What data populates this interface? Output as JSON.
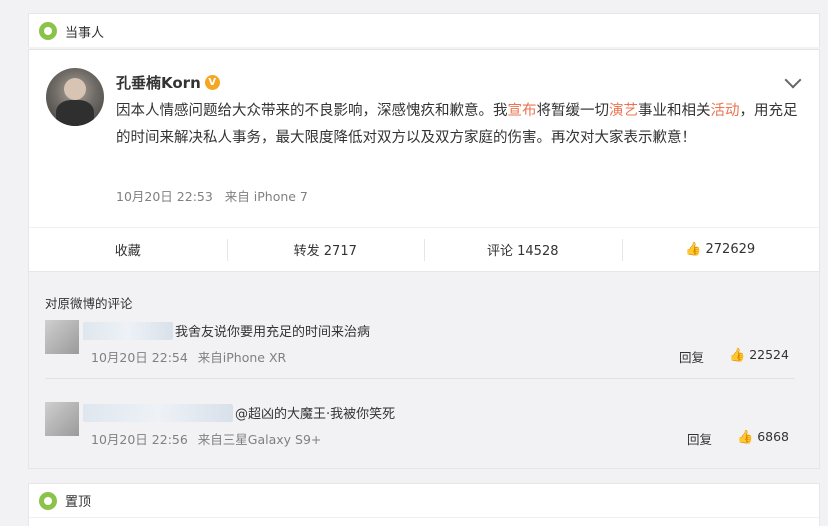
{
  "top_section": {
    "label": "当事人"
  },
  "post": {
    "author": "孔垂楠Korn",
    "verified_mark": "V",
    "text_parts": [
      {
        "text": "因本人情感问题给大众带来的不良影响，深感愧疚和歉意。我",
        "hl": false
      },
      {
        "text": "宣布",
        "hl": true
      },
      {
        "text": "将暂缓一切",
        "hl": false
      },
      {
        "text": "演艺",
        "hl": true
      },
      {
        "text": "事业和相关",
        "hl": false
      },
      {
        "text": "活动",
        "hl": true
      },
      {
        "text": "，用充足的时间来解决私人事务，最大限度降低对双方以及双方家庭的伤害。再次对大家表示歉意！",
        "hl": false
      }
    ],
    "time": "10月20日 22:53",
    "source": "来自 iPhone 7",
    "actions": {
      "favorite": "收藏",
      "repost": "转发 2717",
      "comment": "评论 14528",
      "like": "272629"
    }
  },
  "comments_section": {
    "title": "对原微博的评论",
    "items": [
      {
        "text": "我舍友说你要用充足的时间来治病",
        "time": "10月20日 22:54",
        "source": "来自iPhone XR",
        "reply": "回复",
        "likes": "22524"
      },
      {
        "text": "@超凶的大魔王·我被你笑死",
        "time": "10月20日 22:56",
        "source": "来自三星Galaxy S9+",
        "reply": "回复",
        "likes": "6868"
      }
    ]
  },
  "bottom_section": {
    "label": "置顶"
  },
  "colors": {
    "accent": "#eb7350",
    "icon_green": "#8bc34a",
    "verified": "#f5a623"
  },
  "icons": [
    "section-dot-icon",
    "verified-icon",
    "chevron-down-icon",
    "thumb-up-icon"
  ]
}
